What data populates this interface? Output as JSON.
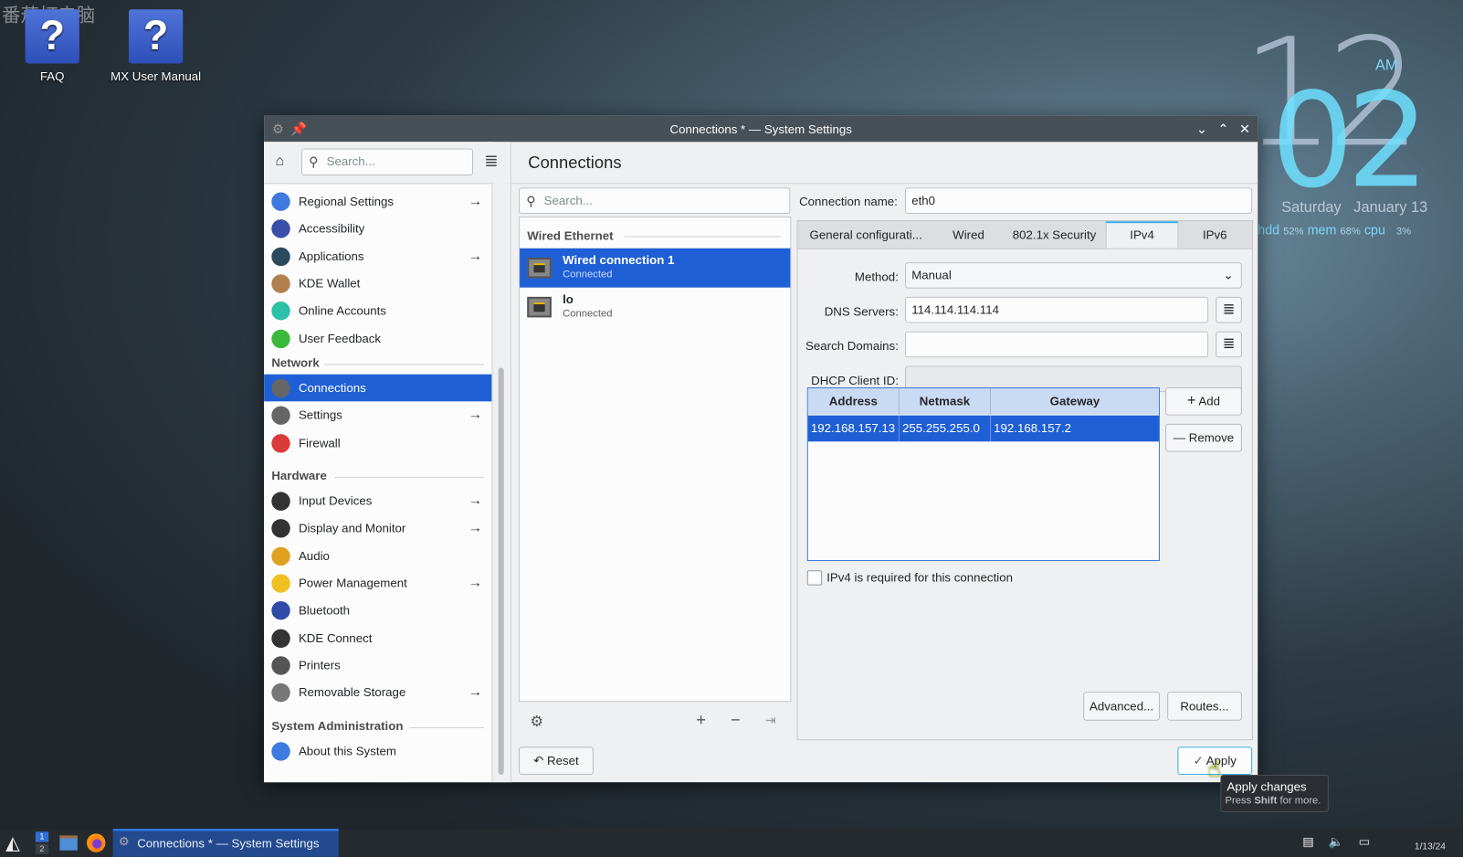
{
  "desktop": {
    "watermark": "番茄打电脑",
    "icons": [
      {
        "label": "FAQ",
        "icon": "help-icon"
      },
      {
        "label": "MX User Manual",
        "icon": "help-icon"
      }
    ],
    "clock": {
      "hour": "12",
      "minute": "02",
      "ampm": "AM",
      "date": "Saturday   January 13",
      "stats": {
        "hdd_label": "hdd",
        "hdd": "52%",
        "mem_label": "mem",
        "mem": "68%",
        "cpu_label": "cpu",
        "cpu": "3%"
      }
    }
  },
  "window": {
    "title": "Connections * — System Settings",
    "sidebar": {
      "search_placeholder": "Search...",
      "items_top": [
        {
          "label": "Regional Settings",
          "arrow": true,
          "color": "#3d7be0"
        },
        {
          "label": "Accessibility",
          "arrow": false,
          "color": "#3a4fa8"
        },
        {
          "label": "Applications",
          "arrow": true,
          "color": "#2c4a5e"
        },
        {
          "label": "KDE Wallet",
          "arrow": false,
          "color": "#b08050"
        },
        {
          "label": "Online Accounts",
          "arrow": false,
          "color": "#2dc0a8"
        },
        {
          "label": "User Feedback",
          "arrow": false,
          "color": "#3cb93c"
        }
      ],
      "categories": [
        "Network",
        "Hardware",
        "System Administration"
      ],
      "network": [
        {
          "label": "Connections",
          "arrow": false,
          "selected": true,
          "color": "#666"
        },
        {
          "label": "Settings",
          "arrow": true,
          "color": "#666"
        },
        {
          "label": "Firewall",
          "arrow": false,
          "color": "#da3a3a"
        }
      ],
      "hardware": [
        {
          "label": "Input Devices",
          "arrow": true,
          "color": "#333"
        },
        {
          "label": "Display and Monitor",
          "arrow": true,
          "color": "#333"
        },
        {
          "label": "Audio",
          "arrow": false,
          "color": "#e0a020"
        },
        {
          "label": "Power Management",
          "arrow": true,
          "color": "#f0c020"
        },
        {
          "label": "Bluetooth",
          "arrow": false,
          "color": "#2f4aa8"
        },
        {
          "label": "KDE Connect",
          "arrow": false,
          "color": "#333"
        },
        {
          "label": "Printers",
          "arrow": false,
          "color": "#555"
        },
        {
          "label": "Removable Storage",
          "arrow": true,
          "color": "#777"
        }
      ],
      "sysadmin": [
        {
          "label": "About this System",
          "arrow": false,
          "color": "#3d7be0"
        }
      ]
    },
    "main": {
      "page_title": "Connections",
      "list_search_placeholder": "Search...",
      "group": "Wired Ethernet",
      "connections": [
        {
          "name": "Wired connection 1",
          "status": "Connected",
          "selected": true
        },
        {
          "name": "lo",
          "status": "Connected",
          "selected": false
        }
      ],
      "connection_name_label": "Connection name:",
      "connection_name": "eth0",
      "tabs": [
        "General configurati...",
        "Wired",
        "802.1x Security",
        "IPv4",
        "IPv6"
      ],
      "active_tab": "IPv4",
      "method_label": "Method:",
      "method": "Manual",
      "dns_label": "DNS Servers:",
      "dns": "114.114.114.114",
      "search_domains_label": "Search Domains:",
      "search_domains": "",
      "dhcp_label": "DHCP Client ID:",
      "dhcp": "",
      "table": {
        "headers": [
          "Address",
          "Netmask",
          "Gateway"
        ],
        "rows": [
          [
            "192.168.157.13",
            "255.255.255.0",
            "192.168.157.2"
          ]
        ]
      },
      "add": "Add",
      "remove": "Remove",
      "ipv4_required": "IPv4 is required for this connection",
      "ipv4_required_checked": false,
      "advanced": "Advanced...",
      "routes": "Routes...",
      "reset": "Reset",
      "apply": "Apply"
    },
    "tooltip": {
      "title": "Apply changes",
      "hint_pre": "Press ",
      "hint_key": "Shift",
      "hint_post": " for more."
    }
  },
  "taskbar": {
    "task": "Connections * — System Settings",
    "pager": [
      "1",
      "2"
    ],
    "tray_date": "1/13/24"
  },
  "accent": "#1f5fd6"
}
